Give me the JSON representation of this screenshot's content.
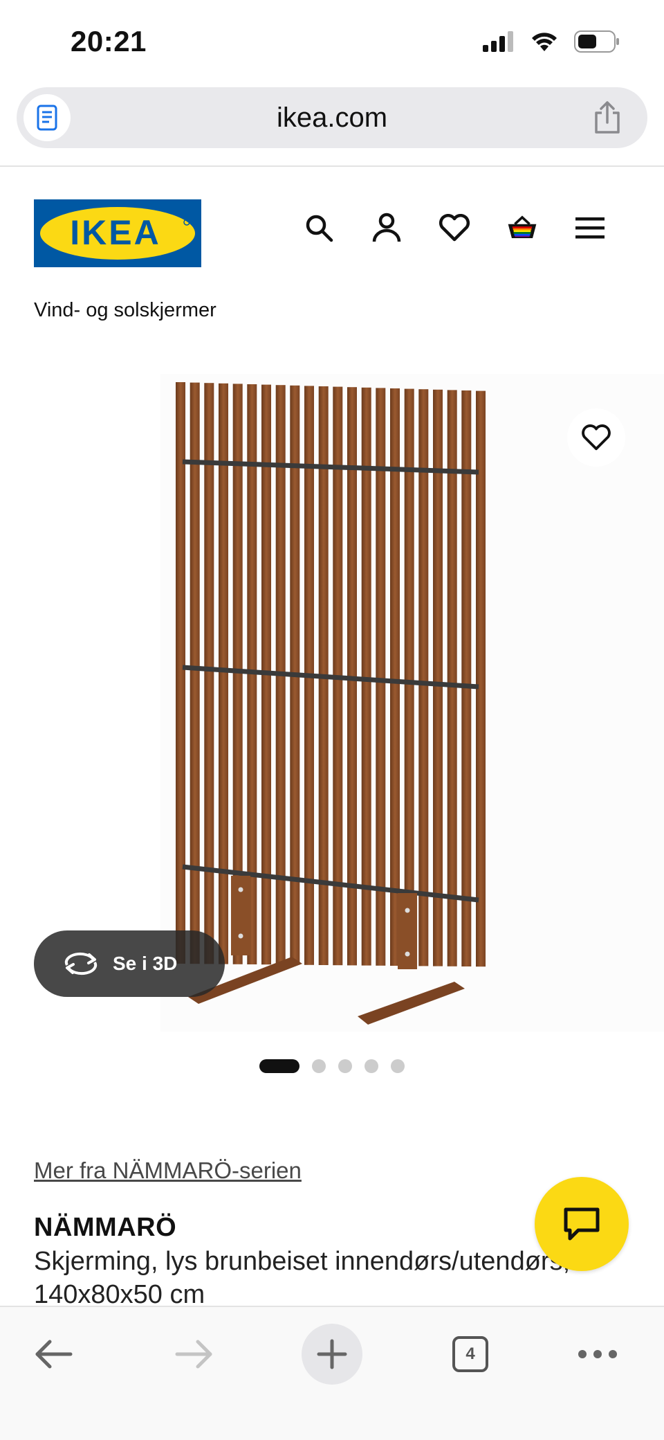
{
  "status_bar": {
    "time": "20:21"
  },
  "browser": {
    "url": "ikea.com",
    "open_tabs": "4"
  },
  "site": {
    "logo_text": "IKEA",
    "brand_colors": {
      "blue": "#0058a3",
      "yellow": "#fbd914"
    },
    "nav_icons": [
      "search-icon",
      "account-icon",
      "heart-icon",
      "basket-icon",
      "menu-icon"
    ]
  },
  "breadcrumb": {
    "category": "Vind- og solskjermer"
  },
  "gallery": {
    "view_3d_label": "Se i 3D",
    "image_count": 5,
    "active_index": 0
  },
  "product": {
    "series_link": "Mer fra NÄMMARÖ-serien",
    "name": "NÄMMARÖ",
    "description": "Skjerming, lys brunbeiset innendørs/utendørs, 140x80x50 cm"
  }
}
